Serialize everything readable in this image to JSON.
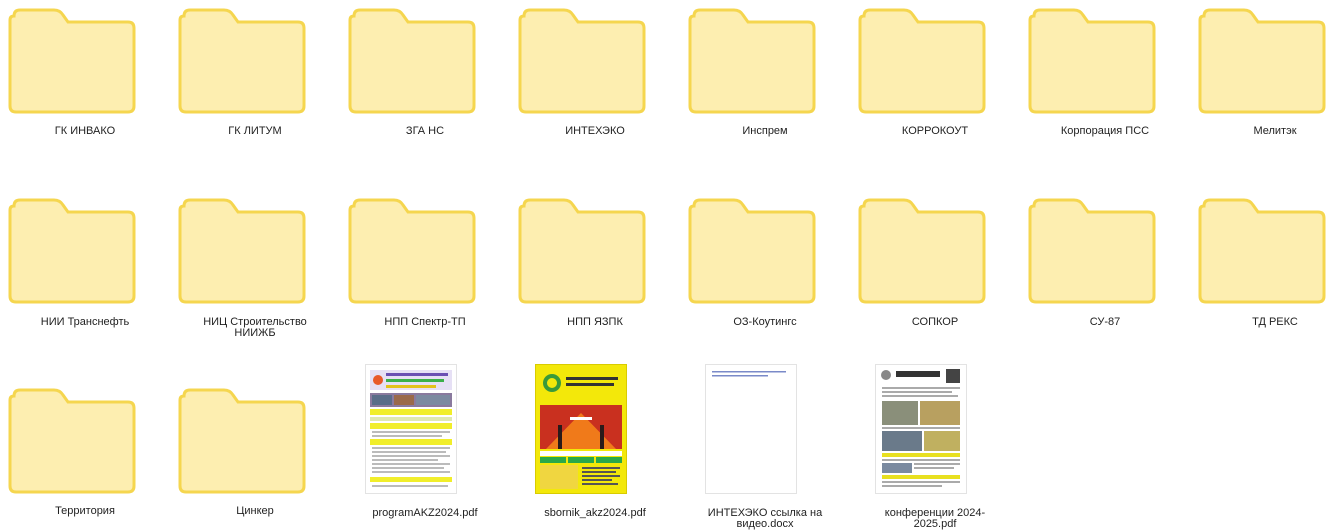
{
  "folders": [
    {
      "name": "ГК ИНВАКО"
    },
    {
      "name": "ГК ЛИТУМ"
    },
    {
      "name": "ЗГА НС"
    },
    {
      "name": "ИНТЕХЭКО"
    },
    {
      "name": "Инспрем"
    },
    {
      "name": "КОРРОКОУТ"
    },
    {
      "name": "Корпорация ПСС"
    },
    {
      "name": "Мелитэк"
    },
    {
      "name": "НИИ Транснефть"
    },
    {
      "name": "НИЦ Строительство НИИЖБ"
    },
    {
      "name": "НПП Спектр-ТП"
    },
    {
      "name": "НПП ЯЗПК"
    },
    {
      "name": "ОЗ-Коутингс"
    },
    {
      "name": "СОПКОР"
    },
    {
      "name": "СУ-87"
    },
    {
      "name": "ТД РЕКС"
    },
    {
      "name": "Территория"
    },
    {
      "name": "Цинкер"
    }
  ],
  "files": [
    {
      "name": "programAKZ2024.pdf",
      "type": "pdf"
    },
    {
      "name": "sbornik_akz2024.pdf",
      "type": "pdf"
    },
    {
      "name": "ИНТЕХЭКО ссылка на видео.docx",
      "type": "docx"
    },
    {
      "name": "конференции 2024-2025.pdf",
      "type": "pdf"
    }
  ],
  "colors": {
    "folder_fill": "#fdeeb0",
    "folder_stroke": "#f5d64f"
  }
}
